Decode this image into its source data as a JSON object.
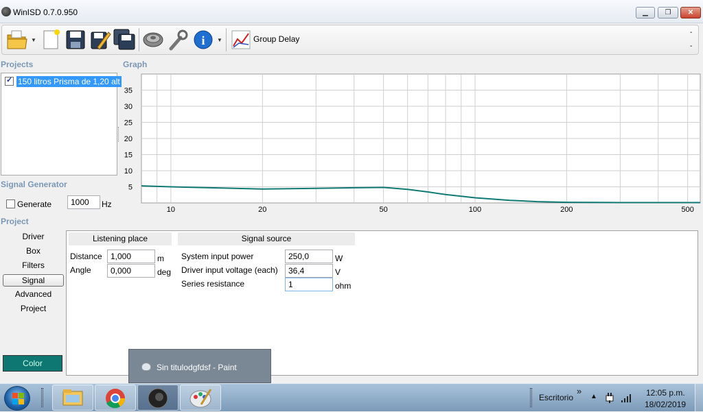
{
  "window": {
    "title": "WinISD 0.7.0.950",
    "controls": [
      "minimize",
      "maximize",
      "close"
    ]
  },
  "toolbar": {
    "icons": [
      "open-folder-icon",
      "new-document-icon",
      "save-icon",
      "edit-icon",
      "save-all-icon",
      "driver-icon",
      "tools-icon",
      "info-icon",
      "graph-icon"
    ],
    "graph_label": "Group Delay",
    "dash1": "-",
    "dash2": "-"
  },
  "projects": {
    "label": "Projects",
    "items": [
      {
        "label": "150 litros Prisma de 1,20 alt",
        "checked": true
      }
    ]
  },
  "graph": {
    "label": "Graph"
  },
  "chart_data": {
    "type": "line",
    "title": "Group Delay",
    "xscale": "log",
    "xlim": [
      8,
      550
    ],
    "ylim": [
      0,
      40
    ],
    "x_ticks": [
      "10",
      "20",
      "50",
      "100",
      "200",
      "500"
    ],
    "y_ticks": [
      "5",
      "10",
      "15",
      "20",
      "25",
      "30",
      "35"
    ],
    "grid": true,
    "series": [
      {
        "color": "#0f7a74",
        "x": [
          8,
          10,
          15,
          20,
          30,
          40,
          50,
          60,
          70,
          80,
          100,
          130,
          160,
          200,
          300,
          400,
          550
        ],
        "y": [
          5.3,
          5.0,
          4.6,
          4.3,
          4.5,
          4.7,
          4.8,
          4.2,
          3.4,
          2.6,
          1.6,
          0.8,
          0.4,
          0.2,
          0.1,
          0.1,
          0.1
        ]
      }
    ]
  },
  "signal_generator": {
    "label": "Signal Generator",
    "generate_label": "Generate",
    "generate_checked": false,
    "frequency": "1000",
    "unit": "Hz"
  },
  "project_nav": {
    "label": "Project",
    "items": [
      "Driver",
      "Box",
      "Filters",
      "Signal",
      "Advanced",
      "Project"
    ],
    "active": "Signal",
    "color_button": "Color",
    "color_value": "#0e7771"
  },
  "listening_place": {
    "header": "Listening place",
    "distance_label": "Distance",
    "distance": "1,000",
    "distance_unit": "m",
    "angle_label": "Angle",
    "angle": "0,000",
    "angle_unit": "deg"
  },
  "signal_source": {
    "header": "Signal source",
    "power_label": "System input power",
    "power": "250,0",
    "power_unit": "W",
    "voltage_label": "Driver input voltage (each)",
    "voltage": "36,4",
    "voltage_unit": "V",
    "resistance_label": "Series resistance",
    "resistance": "1",
    "resistance_unit": "ohm"
  },
  "tooltip": {
    "label": "Sin titulodgfdsf - Paint"
  },
  "taskbar": {
    "apps": [
      "explorer-icon",
      "chrome-icon",
      "winisd-icon",
      "paint-icon"
    ],
    "active_app": "winisd-icon",
    "toolbar_name": "Escritorio",
    "chevron": "»",
    "time": "12:05 p.m.",
    "date": "18/02/2019"
  }
}
